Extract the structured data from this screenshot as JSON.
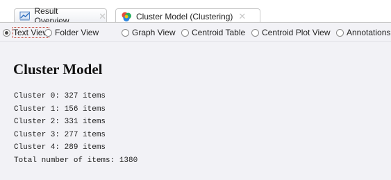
{
  "tabs": [
    {
      "label": "Result Overview",
      "icon": "result-overview-icon",
      "active": false
    },
    {
      "label": "Cluster Model (Clustering)",
      "icon": "cluster-model-icon",
      "active": true
    }
  ],
  "views": [
    {
      "label": "Text View",
      "selected": true
    },
    {
      "label": "Folder View",
      "selected": false
    },
    {
      "label": "Graph View",
      "selected": false
    },
    {
      "label": "Centroid Table",
      "selected": false
    },
    {
      "label": "Centroid Plot View",
      "selected": false
    },
    {
      "label": "Annotations",
      "selected": false
    }
  ],
  "content": {
    "title": "Cluster Model",
    "lines": [
      "Cluster 0: 327 items",
      "Cluster 1: 156 items",
      "Cluster 2: 331 items",
      "Cluster 3: 277 items",
      "Cluster 4: 289 items",
      "Total number of items: 1380"
    ]
  },
  "colors": {
    "panel_background": "#f2f2f6",
    "tab_border": "#c9c9c9"
  }
}
